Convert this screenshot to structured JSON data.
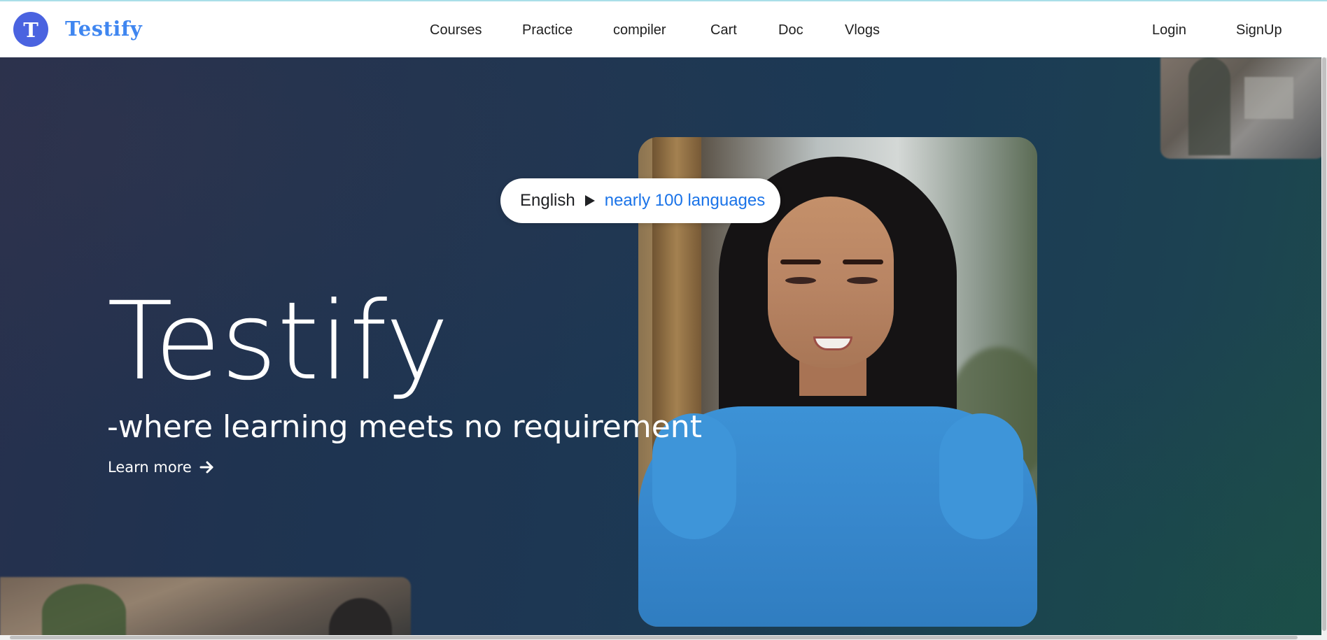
{
  "brand": {
    "logo_letter": "T",
    "name": "Testify",
    "accent": "#3f86f0",
    "badge_color": "#4a63e0"
  },
  "nav": {
    "items": [
      {
        "label": "Courses"
      },
      {
        "label": "Practice"
      },
      {
        "label": "compiler"
      },
      {
        "label": "Cart"
      },
      {
        "label": "Doc"
      },
      {
        "label": "Vlogs"
      }
    ],
    "auth": [
      {
        "label": "Login"
      },
      {
        "label": "SignUp"
      }
    ]
  },
  "hero": {
    "title": "Testify",
    "subtitle": "-where learning meets no requirement",
    "cta_label": "Learn more",
    "cta_icon": "arrow-right-icon",
    "translation_pill": {
      "from": "English",
      "arrow_icon": "play-triangle-icon",
      "to": "nearly 100 languages",
      "to_color": "#1a73e8"
    }
  }
}
